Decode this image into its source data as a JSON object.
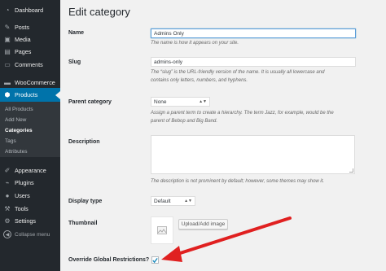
{
  "sidebar": {
    "items": [
      {
        "label": "Dashboard",
        "icon": "dashboard-icon"
      },
      {
        "label": "Posts",
        "icon": "pin-icon"
      },
      {
        "label": "Media",
        "icon": "media-icon"
      },
      {
        "label": "Pages",
        "icon": "pages-icon"
      },
      {
        "label": "Comments",
        "icon": "comments-icon"
      },
      {
        "label": "WooCommerce",
        "icon": "woocommerce-icon"
      },
      {
        "label": "Products",
        "icon": "products-icon"
      },
      {
        "label": "Appearance",
        "icon": "appearance-icon"
      },
      {
        "label": "Plugins",
        "icon": "plugins-icon"
      },
      {
        "label": "Users",
        "icon": "users-icon"
      },
      {
        "label": "Tools",
        "icon": "tools-icon"
      },
      {
        "label": "Settings",
        "icon": "settings-icon"
      }
    ],
    "submenu": [
      "All Products",
      "Add New",
      "Categories",
      "Tags",
      "Attributes"
    ],
    "collapse_label": "Collapse menu"
  },
  "page": {
    "title": "Edit category"
  },
  "form": {
    "name_label": "Name",
    "name_value": "Admins Only",
    "name_desc": "The name is how it appears on your site.",
    "slug_label": "Slug",
    "slug_value": "admins-only",
    "slug_desc_1": "The “slug” is the URL-friendly version of the name. It is usually all lowercase and",
    "slug_desc_2": "contains only letters, numbers, and hyphens.",
    "parent_label": "Parent category",
    "parent_value": "None",
    "parent_desc_1": "Assign a parent term to create a hierarchy. The term Jazz, for example, would be the",
    "parent_desc_2": "parent of Bebop and Big Band.",
    "description_label": "Description",
    "description_desc": "The description is not prominent by default; however, some themes may show it.",
    "display_type_label": "Display type",
    "display_type_value": "Default",
    "thumbnail_label": "Thumbnail",
    "upload_button": "Upload/Add image",
    "override_label": "Override Global Restrictions?"
  },
  "colors": {
    "sidebar_bg": "#23282d",
    "active_bg": "#0073aa",
    "arrow": "#e02020"
  }
}
